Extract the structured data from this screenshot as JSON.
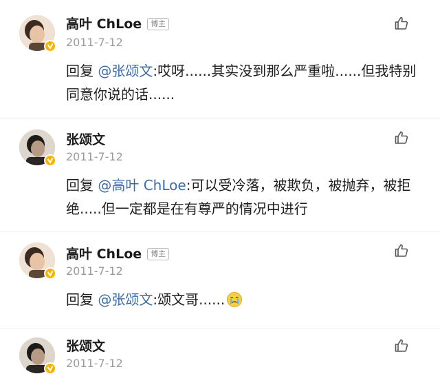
{
  "comments": [
    {
      "author": "高叶 ChLoe",
      "badge": "博主",
      "date": "2011-7-12",
      "reply_prefix": "回复 ",
      "mention": "@张颂文",
      "body": ":哎呀......其实没到那么严重啦......但我特别同意你说的话......",
      "avatar_icon": "avatar-gaoye",
      "verified_icon": "verified-badge-icon"
    },
    {
      "author": "张颂文",
      "badge": "",
      "date": "2011-7-12",
      "reply_prefix": "回复 ",
      "mention": "@高叶 ChLoe",
      "body": ":可以受冷落，被欺负，被抛弃，被拒绝.....但一定都是在有尊严的情况中进行",
      "avatar_icon": "avatar-zhangsongwen",
      "verified_icon": "verified-badge-icon"
    },
    {
      "author": "高叶 ChLoe",
      "badge": "博主",
      "date": "2011-7-12",
      "reply_prefix": "回复 ",
      "mention": "@张颂文",
      "body": ":颂文哥......",
      "avatar_icon": "avatar-gaoye",
      "verified_icon": "verified-badge-icon",
      "trailing_emoji": "crying-face-emoji"
    },
    {
      "author": "张颂文",
      "badge": "",
      "date": "2011-7-12",
      "avatar_icon": "avatar-zhangsongwen",
      "verified_icon": "verified-badge-icon"
    }
  ],
  "like_icon": "thumbs-up-icon",
  "colors": {
    "mention": "#3b6ea8",
    "date": "#9a9a9a",
    "verified": "#f5b400"
  }
}
